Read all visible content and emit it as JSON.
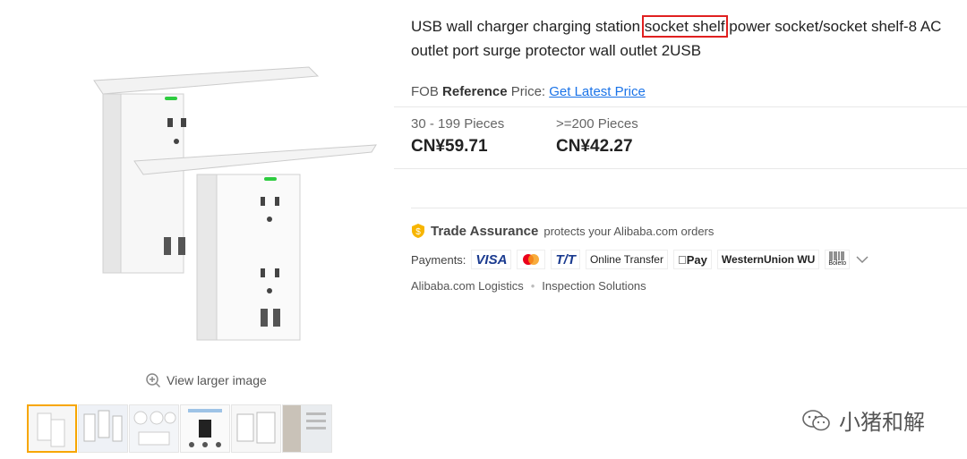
{
  "product": {
    "title_pre": "USB wall charger charging station ",
    "title_highlight": "socket shelf",
    "title_post": " power socket/socket shelf-8 AC outlet port surge protector wall outlet 2USB"
  },
  "fob": {
    "prefix": "FOB ",
    "reference": "Reference",
    "price_label": " Price:",
    "link": "Get Latest Price"
  },
  "price_tiers": [
    {
      "qty": "30 - 199 Pieces",
      "price": "CN¥59.71"
    },
    {
      "qty": ">=200 Pieces",
      "price": "CN¥42.27"
    }
  ],
  "trade_assurance": {
    "title": "Trade Assurance",
    "desc": "protects your Alibaba.com orders"
  },
  "payments": {
    "label": "Payments:",
    "methods": [
      "VISA",
      "",
      "T/T",
      "Online Transfer",
      "Pay",
      "WesternUnion WU",
      "Boleto"
    ]
  },
  "services": [
    "Alibaba.com Logistics",
    "Inspection Solutions"
  ],
  "gallery": {
    "view_larger": "View larger image",
    "thumb_count": 6
  },
  "watermark": {
    "text": "小猪和解"
  },
  "colors": {
    "accent": "#f7a600",
    "highlight_border": "#e02020",
    "link": "#1a73e8"
  }
}
